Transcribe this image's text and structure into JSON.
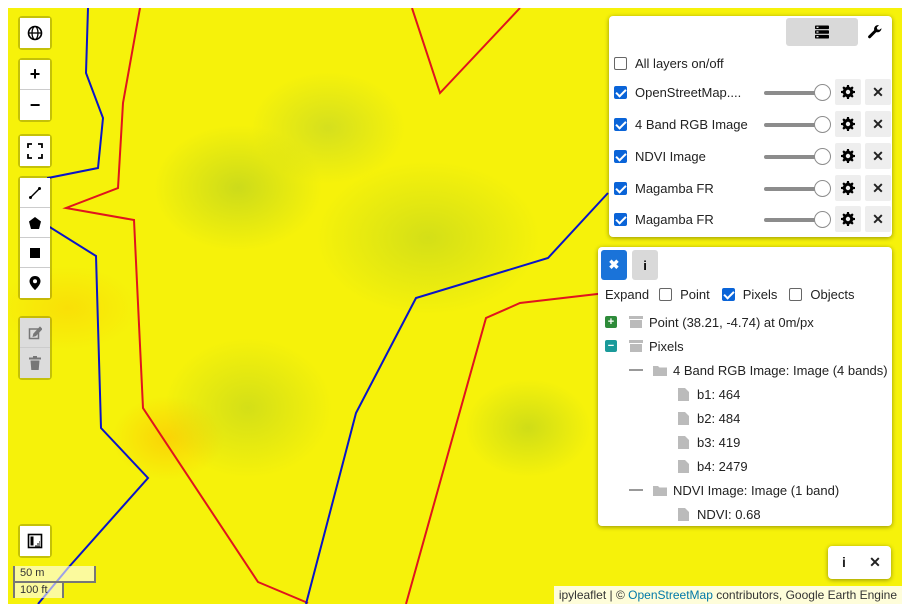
{
  "map": {
    "scale_metric": "50 m",
    "scale_imperial": "100 ft",
    "attribution": {
      "prefix": "ipyleaflet | ©",
      "link": "OpenStreetMap",
      "suffix": "contributors, Google Earth Engine"
    },
    "colors": {
      "background": "#f6f20a",
      "boundary_red": "#e0141e",
      "boundary_blue": "#0a14c8"
    }
  },
  "controls": {
    "globe_icon": "globe-icon",
    "zoom_in": "+",
    "zoom_out": "−"
  },
  "layers_panel": {
    "all_toggle_label": "All layers on/off",
    "all_toggle_checked": false,
    "layers": [
      {
        "name": "OpenStreetMap....",
        "checked": true,
        "opacity": 1.0
      },
      {
        "name": "4 Band RGB Image",
        "checked": true,
        "opacity": 1.0
      },
      {
        "name": "NDVI Image",
        "checked": true,
        "opacity": 1.0
      },
      {
        "name": "Magamba FR",
        "checked": true,
        "opacity": 1.0
      },
      {
        "name": "Magamba FR",
        "checked": true,
        "opacity": 1.0
      }
    ]
  },
  "inspector": {
    "expand_label": "Expand",
    "options": [
      {
        "label": "Point",
        "checked": false
      },
      {
        "label": "Pixels",
        "checked": true
      },
      {
        "label": "Objects",
        "checked": false
      }
    ],
    "tree": {
      "point": "Point (38.21, -4.74) at 0m/px",
      "pixels": "Pixels",
      "rgb_image": "4 Band RGB Image: Image (4 bands)",
      "b1": "b1: 464",
      "b2": "b2: 484",
      "b3": "b3: 419",
      "b4": "b4: 2479",
      "ndvi_image": "NDVI Image: Image (1 band)",
      "ndvi": "NDVI: 0.68"
    }
  }
}
